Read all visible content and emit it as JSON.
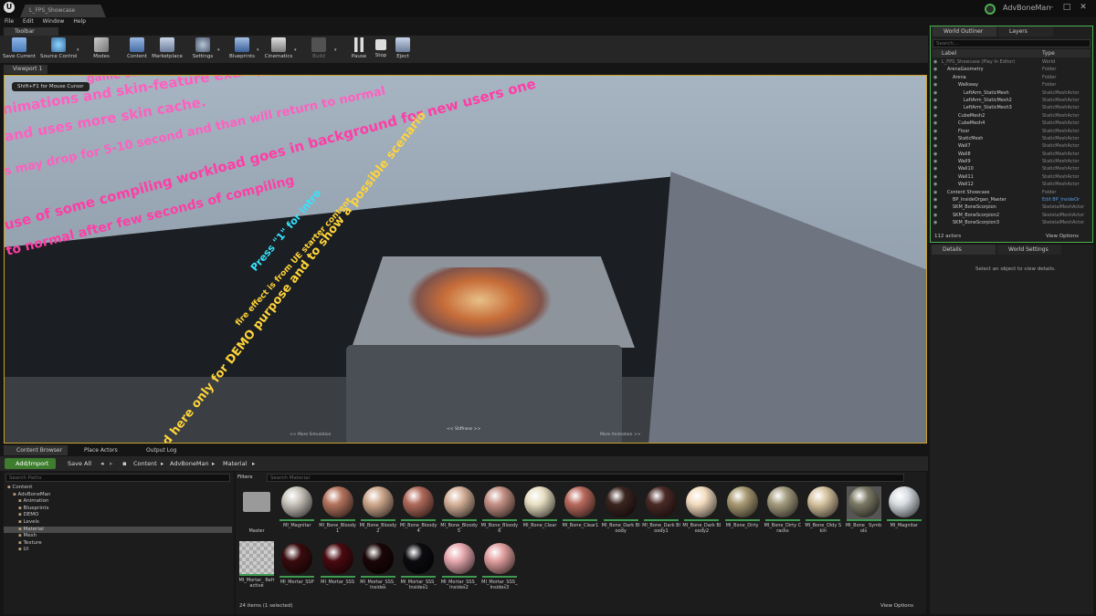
{
  "window": {
    "map_tab": "L_FPS_Showcase",
    "project_name": "AdvBoneMan",
    "minimize_glyph": "–",
    "maximize_glyph": "□",
    "close_glyph": "✕"
  },
  "menu": [
    "File",
    "Edit",
    "Window",
    "Help"
  ],
  "toolbar": {
    "tab_label": "Toolbar",
    "buttons": [
      {
        "label": "Save Current",
        "icon": "save-icon"
      },
      {
        "label": "Source Control",
        "icon": "source-control-icon"
      },
      {
        "label": "Modes",
        "icon": "modes-icon"
      },
      {
        "label": "Content",
        "icon": "content-icon"
      },
      {
        "label": "Marketplace",
        "icon": "marketplace-icon"
      },
      {
        "label": "Settings",
        "icon": "settings-icon"
      },
      {
        "label": "Blueprints",
        "icon": "blueprints-icon"
      },
      {
        "label": "Cinematics",
        "icon": "cinematics-icon"
      },
      {
        "label": "Build",
        "icon": "build-icon"
      },
      {
        "label": "Pause",
        "icon": "pause-icon"
      },
      {
        "label": "Stop",
        "icon": "stop-icon"
      },
      {
        "label": "Eject",
        "icon": "eject-icon"
      }
    ]
  },
  "viewport": {
    "tab_label": "Viewport 1",
    "hint": "Shift+F1 for Mouse Cursor",
    "neon_lines": [
      "nimations and skin-feature examples.",
      "and uses more skin cache.",
      "s may drop for 5-10 second and than will return to normal",
      "use of some compiling workload goes in background for new users one",
      "to normal after few seconds of compiling",
      "Press \"1\" for intro",
      "fire effect is from UE starter content",
      "d here only for DEMO purpose and to show a possible scenario",
      "game settings"
    ],
    "bottom_hints": [
      "<< More Simulation",
      "<< Stiffness >>",
      "More Animation >>"
    ]
  },
  "outliner": {
    "tab_outliner": "World Outliner",
    "tab_layers": "Layers",
    "search_placeholder": "Search...",
    "col_label": "Label",
    "col_type": "Type",
    "rows": [
      {
        "label": "L_FPS_Showcase (Play In Editor)",
        "type": "World",
        "indent": 0
      },
      {
        "label": "ArenaGeometry",
        "type": "Folder",
        "indent": 1
      },
      {
        "label": "Arena",
        "type": "Folder",
        "indent": 2
      },
      {
        "label": "Walkway",
        "type": "Folder",
        "indent": 3
      },
      {
        "label": "LeftArm_StaticMesh",
        "type": "StaticMeshActor",
        "indent": 4
      },
      {
        "label": "LeftArm_StaticMesh2",
        "type": "StaticMeshActor",
        "indent": 4
      },
      {
        "label": "LeftArm_StaticMesh3",
        "type": "StaticMeshActor",
        "indent": 4
      },
      {
        "label": "CubeMesh2",
        "type": "StaticMeshActor",
        "indent": 3
      },
      {
        "label": "CubeMesh4",
        "type": "StaticMeshActor",
        "indent": 3
      },
      {
        "label": "Floor",
        "type": "StaticMeshActor",
        "indent": 3
      },
      {
        "label": "StaticMesh",
        "type": "StaticMeshActor",
        "indent": 3
      },
      {
        "label": "Wall7",
        "type": "StaticMeshActor",
        "indent": 3
      },
      {
        "label": "Wall8",
        "type": "StaticMeshActor",
        "indent": 3
      },
      {
        "label": "Wall9",
        "type": "StaticMeshActor",
        "indent": 3
      },
      {
        "label": "Wall10",
        "type": "StaticMeshActor",
        "indent": 3
      },
      {
        "label": "Wall11",
        "type": "StaticMeshActor",
        "indent": 3
      },
      {
        "label": "Wall12",
        "type": "StaticMeshActor",
        "indent": 3
      },
      {
        "label": "Content Showcase",
        "type": "Folder",
        "indent": 1
      },
      {
        "label": "BP_InsideOrgan_Master",
        "type": "Edit BP_InsideOr",
        "indent": 2
      },
      {
        "label": "SKM_BoneScorpion",
        "type": "SkeletalMeshActor",
        "indent": 2
      },
      {
        "label": "SKM_BoneScorpion2",
        "type": "SkeletalMeshActor",
        "indent": 2
      },
      {
        "label": "SKM_BoneScorpion3",
        "type": "SkeletalMeshActor",
        "indent": 2
      }
    ],
    "actor_count": "112 actors",
    "view_options": "View Options"
  },
  "details": {
    "tab_details": "Details",
    "tab_world_settings": "World Settings",
    "empty_message": "Select an object to view details."
  },
  "bottom_tabs": [
    "Content Browser",
    "Place Actors",
    "Output Log"
  ],
  "content_browser": {
    "add_import": "Add/Import",
    "save_all": "Save All",
    "breadcrumb": [
      "Content",
      "AdvBoneMan",
      "Material"
    ],
    "paths_search_placeholder": "Search Paths",
    "tree": [
      {
        "label": "Content",
        "indent": 0,
        "selected": false
      },
      {
        "label": "AdvBoneMan",
        "indent": 1,
        "selected": false
      },
      {
        "label": "Animation",
        "indent": 2,
        "selected": false
      },
      {
        "label": "Blueprints",
        "indent": 2,
        "selected": false
      },
      {
        "label": "DEMO",
        "indent": 2,
        "selected": false
      },
      {
        "label": "Levels",
        "indent": 2,
        "selected": false
      },
      {
        "label": "Material",
        "indent": 2,
        "selected": true
      },
      {
        "label": "Mesh",
        "indent": 2,
        "selected": false
      },
      {
        "label": "Texture",
        "indent": 2,
        "selected": false
      },
      {
        "label": "UI",
        "indent": 2,
        "selected": false
      }
    ],
    "filters_label": "Filters",
    "assets_search_placeholder": "Search Material",
    "assets": [
      {
        "name": "Master",
        "color": "folder"
      },
      {
        "name": "MI_Magnitar",
        "color": "#c9c4bc"
      },
      {
        "name": "MI_Bone_Bloody1",
        "color": "#b5745f"
      },
      {
        "name": "MI_Bone_Bloody2",
        "color": "#cfa98e"
      },
      {
        "name": "MI_Bone_Bloody4",
        "color": "#b06a5b"
      },
      {
        "name": "MI_Bone_Bloody5",
        "color": "#d6b29a"
      },
      {
        "name": "MI_Bone_Bloody6",
        "color": "#c49085"
      },
      {
        "name": "MI_Bone_Clear",
        "color": "#e8dfc3"
      },
      {
        "name": "MI_Bone_Clear1",
        "color": "#b96a5e"
      },
      {
        "name": "MI_Bone_Dark Bloody",
        "color": "#3b2420"
      },
      {
        "name": "MI_Bone_Dark Bloody1",
        "color": "#4a2a26"
      },
      {
        "name": "MI_Bone_Dark Bloody2",
        "color": "#f3dcc0"
      },
      {
        "name": "MI_Bone_Dirty",
        "color": "#a89a73"
      },
      {
        "name": "MI_Bone_Dirty Cracks",
        "color": "#a59c7f"
      },
      {
        "name": "MI_Bone_Oldy Skin",
        "color": "#d6c3a0"
      },
      {
        "name": "MI_Bone_ Symbols",
        "color": "#7c7a66"
      },
      {
        "name": "MI_Magnitar",
        "color": "#d8dde2"
      },
      {
        "name": "MI_Mortar_ Refractive",
        "color": "checker"
      },
      {
        "name": "MI_Mortar_SSP",
        "color": "#3a0c0e"
      },
      {
        "name": "MI_Mortar_SSS",
        "color": "#4a0a10"
      },
      {
        "name": "MI_Mortar_SSS_ Insides",
        "color": "#1a0608"
      },
      {
        "name": "MI_Mortar_SSS_ Insides1",
        "color": "#0c0c10"
      },
      {
        "name": "MI_Mortar_SSS_ Insides2",
        "color": "#e8aab0"
      },
      {
        "name": "MI_Mortar_SSS_ Insides3",
        "color": "#e2a0a0"
      }
    ],
    "items_count": "24 items (1 selected)",
    "view_options": "View Options"
  },
  "colors": {
    "accent_green": "#4caf50",
    "selection_gold": "#c9a12b",
    "neon_pink": "#ff3da6",
    "neon_cyan": "#35e4ff",
    "neon_yellow": "#ffd43a"
  }
}
